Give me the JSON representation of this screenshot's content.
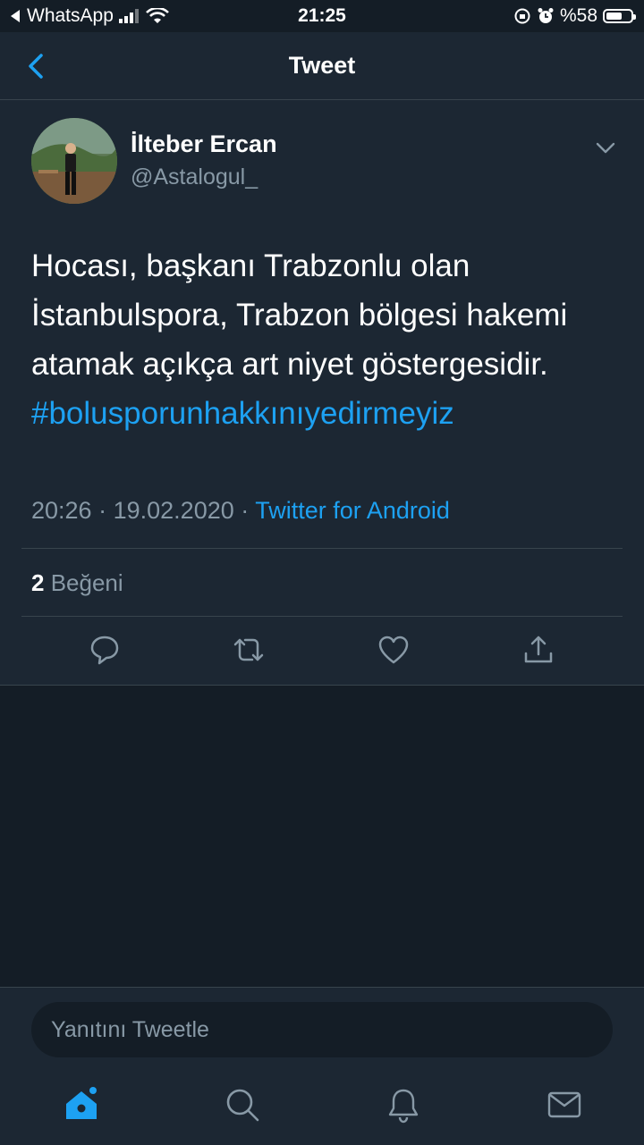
{
  "status_bar": {
    "back_app": "WhatsApp",
    "time": "21:25",
    "battery": "%58"
  },
  "header": {
    "title": "Tweet"
  },
  "tweet": {
    "author_name": "İlteber Ercan",
    "author_handle": "@Astalogul_",
    "text_lines": [
      "Hocası, başkanı Trabzonlu olan",
      "İstanbulspora, Trabzon bölgesi hakemi",
      "atamak açıkça art niyet göstergesidir."
    ],
    "hashtag": "#bolusporunhakkınıyedirmeyiz",
    "time": "20:26",
    "separator": "·",
    "date": "19.02.2020",
    "source": "Twitter for Android",
    "likes_count": "2",
    "likes_label": "Beğeni"
  },
  "actions": [
    "reply-icon",
    "retweet-icon",
    "like-icon",
    "share-icon"
  ],
  "reply": {
    "placeholder": "Yanıtını Tweetle"
  },
  "bottom_nav": [
    "home-icon",
    "search-icon",
    "notifications-icon",
    "messages-icon"
  ],
  "colors": {
    "accent": "#1da1f2",
    "background": "#141d26",
    "card": "#1c2733",
    "secondary_text": "#8899a6",
    "divider": "#38444d"
  }
}
